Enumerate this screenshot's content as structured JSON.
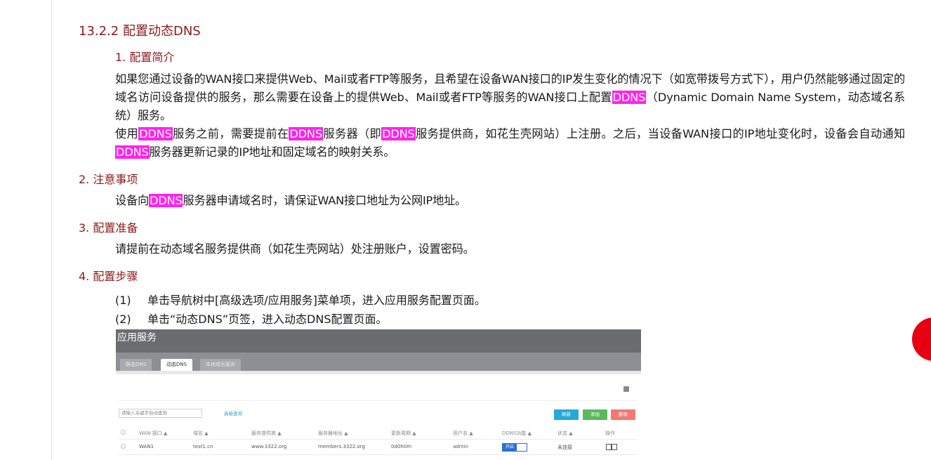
{
  "section_title": "13.2.2  配置动态DNS",
  "s1": {
    "title": "1. 配置简介",
    "p1a": "如果您通过设备的WAN接口来提供Web、Mail或者FTP等服务，且希望在设备WAN接口的IP发生变化的情况下（如宽带拨号方式下），用户仍然能够通过固定的域名访问设备提供的服务，那么需要在设备上的提供Web、Mail或者FTP等服务的WAN接口上配置",
    "p1b": "（Dynamic Domain Name System，动态域名系统）服务。",
    "p2a": "使用",
    "p2b": "服务之前，需要提前在",
    "p2c": "服务器（即",
    "p2d": "服务提供商，如花生壳网站）上注册。之后，当设备WAN接口的IP地址变化时，设备会自动通知",
    "p2e": "服务器更新记录的IP地址和固定域名的映射关系。",
    "ddns": "DDNS"
  },
  "s2": {
    "title": "2. 注意事项",
    "pa": "设备向",
    "pb": "服务器申请域名时，请保证WAN接口地址为公网IP地址。"
  },
  "s3": {
    "title": "3. 配置准备",
    "p": "请提前在动态域名服务提供商（如花生壳网站）处注册账户，设置密码。"
  },
  "s4": {
    "title": "4. 配置步骤",
    "steps": [
      {
        "num": "(1)",
        "text": "单击导航树中[高级选项/应用服务]菜单项，进入应用服务配置页面。"
      },
      {
        "num": "(2)",
        "text": "单击“动态DNS”页签，进入动态DNS配置页面。"
      }
    ]
  },
  "screenshot": {
    "header": "应用服务",
    "tabs": [
      "静态DNS",
      "动态DNS",
      "本地域名服务"
    ],
    "search_placeholder": "请输入关键字自动查询",
    "advanced": "高级查询",
    "buttons": {
      "refresh": "刷新",
      "add": "添加",
      "delete": "删除"
    },
    "button_colors": {
      "refresh": "#27a8d8",
      "add": "#5cb85c",
      "delete": "#f07a72"
    },
    "columns": [
      "WAN 接口 ▲",
      "域名 ▲",
      "服务提供商 ▲",
      "服务器地址 ▲",
      "更新周期 ▲",
      "用户名 ▲",
      "DDNS功能 ▲",
      "状态 ▲",
      "操作"
    ],
    "row": [
      "WAN1",
      "test1.cn",
      "www.3322.org",
      "members.3322.org",
      "0d0h0m",
      "admin",
      "开启",
      "未连接"
    ]
  }
}
